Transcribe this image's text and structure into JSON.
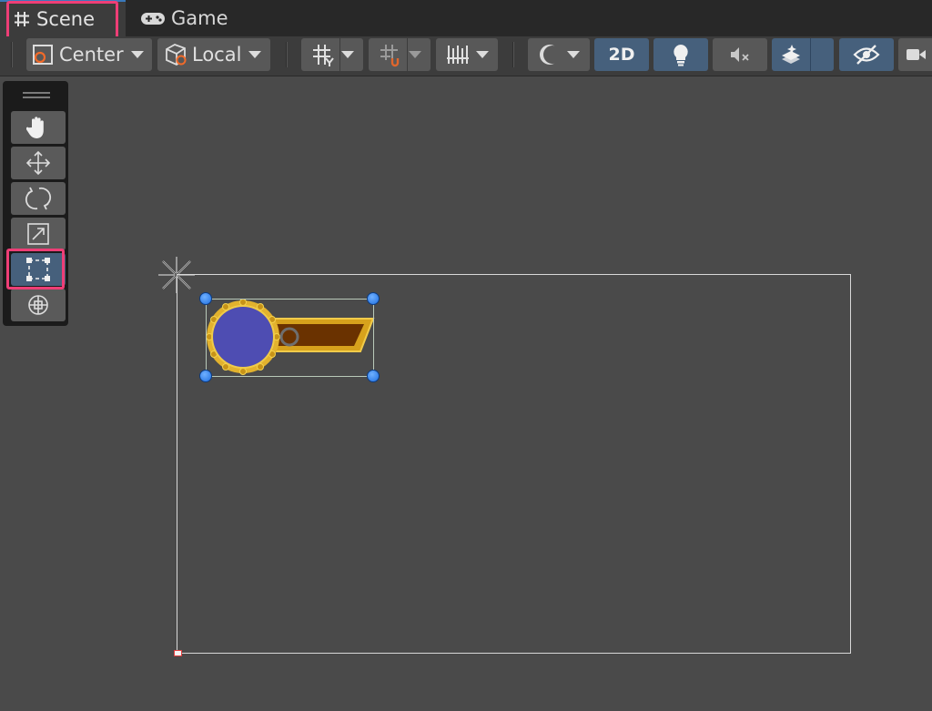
{
  "tabs": {
    "scene": {
      "label": "Scene",
      "icon": "grid-hash-icon"
    },
    "game": {
      "label": "Game",
      "icon": "gamepad-icon"
    }
  },
  "toolbar": {
    "pivot_mode": "Center",
    "pivot_rotation": "Local",
    "toggle_2d": "2D",
    "icons": [
      "pivot-mode-icon",
      "pivot-rotation-icon",
      "grid-snapping-icon",
      "increment-snap-icon",
      "ruler-icon",
      "draw-mode-icon",
      "lighting-icon",
      "audio-mute-icon",
      "effects-icon",
      "scene-visibility-icon",
      "camera-icon"
    ]
  },
  "tools": {
    "items": [
      "hand-tool",
      "move-tool",
      "rotate-tool",
      "scale-tool",
      "rect-tool",
      "transform-tool"
    ],
    "active": "rect-tool"
  },
  "colors": {
    "highlight": "#ee3e76",
    "active_blue": "#46607c",
    "handle_blue": "#1f6fe0",
    "scene_bg": "#4a4a4a"
  },
  "scene_objects": {
    "hp_bar": {
      "circle_color": "#4e4db2",
      "fill_color": "#6a3200",
      "frame_color": "#e6b634"
    }
  }
}
